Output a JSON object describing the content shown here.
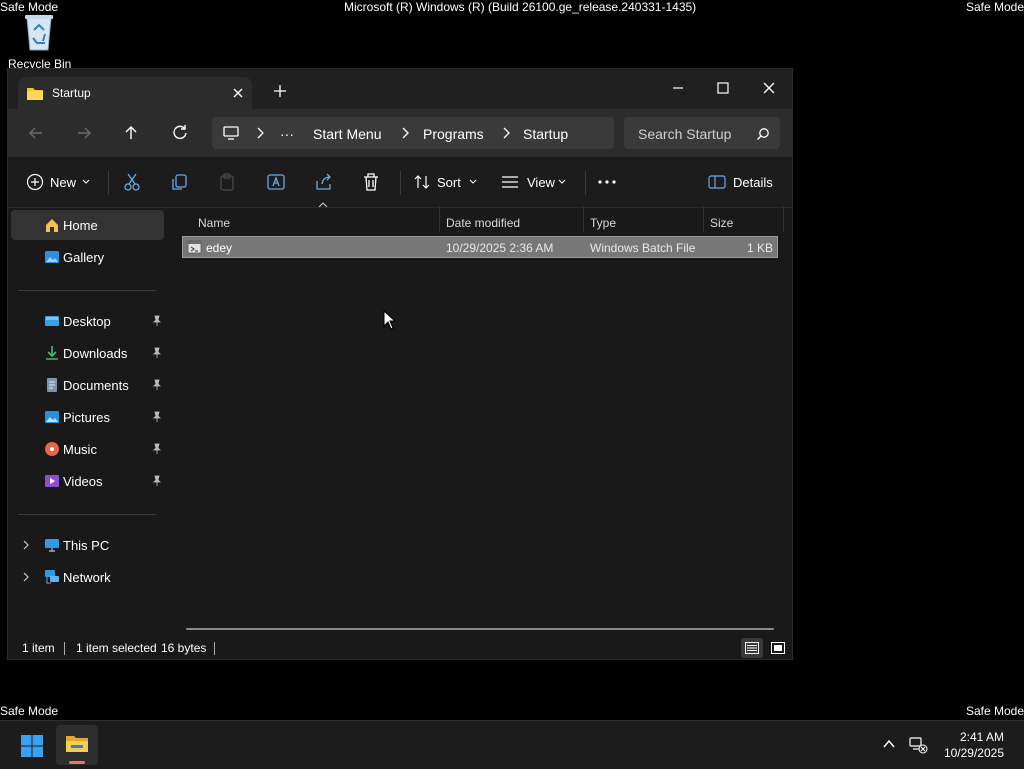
{
  "desktop": {
    "top_center_text": "Microsoft (R) Windows (R) (Build 26100.ge_release.240331-1435)",
    "safe_mode_label": "Safe Mode",
    "recycle_bin_label": "Recycle Bin"
  },
  "window": {
    "tab_title": "Startup",
    "address_crumbs": [
      "Start Menu",
      "Programs",
      "Startup"
    ],
    "search_placeholder": "Search Startup",
    "toolbar": {
      "new_label": "New",
      "sort_label": "Sort",
      "view_label": "View",
      "details_label": "Details"
    },
    "sidebar": {
      "top_items": [
        {
          "label": "Home",
          "icon": "home-icon",
          "selected": true
        },
        {
          "label": "Gallery",
          "icon": "gallery-icon",
          "selected": false
        }
      ],
      "pinned_items": [
        {
          "label": "Desktop",
          "icon": "desktop-folder-icon"
        },
        {
          "label": "Downloads",
          "icon": "downloads-icon"
        },
        {
          "label": "Documents",
          "icon": "documents-icon"
        },
        {
          "label": "Pictures",
          "icon": "pictures-icon"
        },
        {
          "label": "Music",
          "icon": "music-icon"
        },
        {
          "label": "Videos",
          "icon": "videos-icon"
        }
      ],
      "tree_items": [
        {
          "label": "This PC",
          "icon": "this-pc-icon"
        },
        {
          "label": "Network",
          "icon": "network-icon"
        }
      ]
    },
    "columns": [
      "Name",
      "Date modified",
      "Type",
      "Size"
    ],
    "files": [
      {
        "name": "edey",
        "date_modified": "10/29/2025 2:36 AM",
        "type": "Windows Batch File",
        "size": "1 KB",
        "selected": true
      }
    ],
    "status": {
      "item_count": "1 item",
      "selection": "1 item selected",
      "selection_size": "16 bytes"
    }
  },
  "taskbar": {
    "time": "2:41 AM",
    "date": "10/29/2025"
  },
  "colors": {
    "accent_folder": "#f4c430",
    "selection_row": "#777777",
    "taskbar_indicator": "#e07a5f"
  }
}
